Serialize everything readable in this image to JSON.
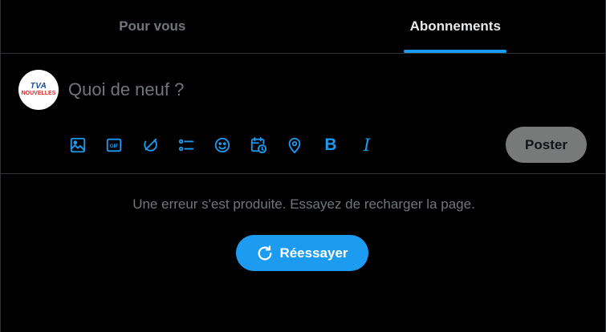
{
  "tabs": [
    {
      "label": "Pour vous",
      "active": false
    },
    {
      "label": "Abonnements",
      "active": true
    }
  ],
  "composer": {
    "avatar": {
      "line1": "TVA",
      "line2": "NOUVELLES"
    },
    "placeholder": "Quoi de neuf ?",
    "toolbar_icons": [
      "image-icon",
      "gif-icon",
      "grok-icon",
      "poll-icon",
      "emoji-icon",
      "schedule-icon",
      "location-icon",
      "bold-icon",
      "italic-icon"
    ],
    "bold_glyph": "B",
    "italic_glyph": "I",
    "post_label": "Poster"
  },
  "error": {
    "message": "Une erreur s'est produite. Essayez de recharger la page.",
    "retry_label": "Réessayer"
  },
  "colors": {
    "accent": "#1d9bf0",
    "background": "#000000",
    "muted_text": "#71767b",
    "border": "#2f3336",
    "post_button_disabled": "#787a7a"
  }
}
